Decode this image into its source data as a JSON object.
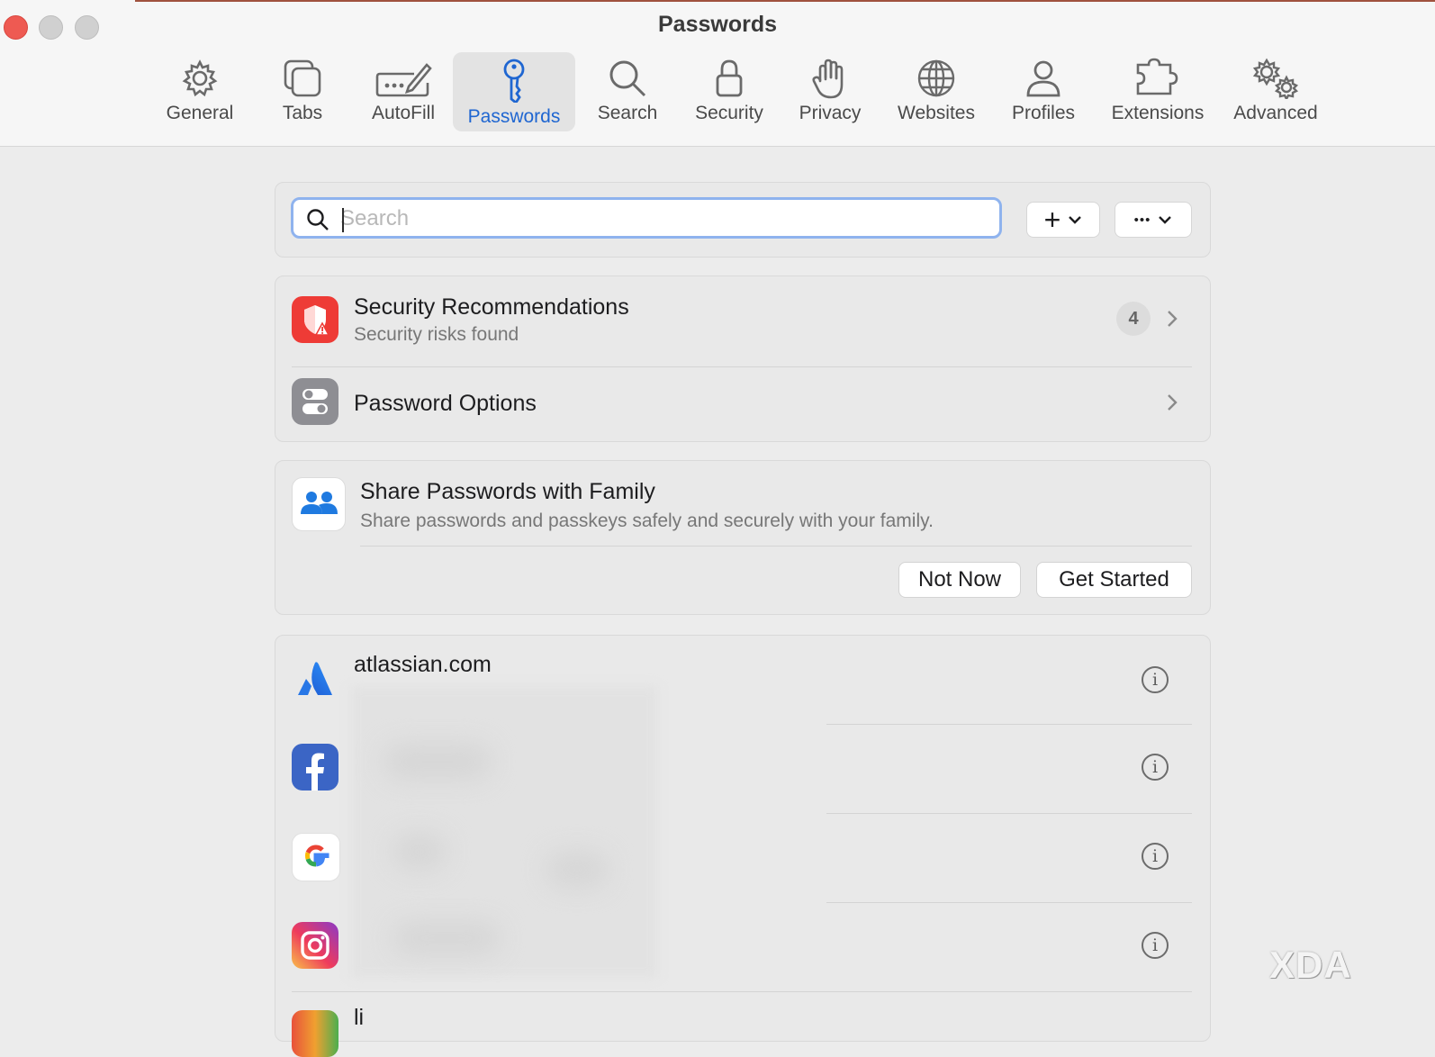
{
  "window": {
    "title": "Passwords"
  },
  "toolbar": {
    "tabs": [
      {
        "label": "General",
        "icon": "gear-icon"
      },
      {
        "label": "Tabs",
        "icon": "tabs-icon"
      },
      {
        "label": "AutoFill",
        "icon": "pencil-field-icon"
      },
      {
        "label": "Passwords",
        "icon": "key-icon",
        "active": true
      },
      {
        "label": "Search",
        "icon": "search-icon"
      },
      {
        "label": "Security",
        "icon": "lock-icon"
      },
      {
        "label": "Privacy",
        "icon": "hand-icon"
      },
      {
        "label": "Websites",
        "icon": "globe-icon"
      },
      {
        "label": "Profiles",
        "icon": "person-icon"
      },
      {
        "label": "Extensions",
        "icon": "puzzle-icon"
      },
      {
        "label": "Advanced",
        "icon": "gears-icon"
      }
    ]
  },
  "search": {
    "placeholder": "Search",
    "value": ""
  },
  "actions": {
    "add": "+",
    "more": "•••"
  },
  "security": {
    "title": "Security Recommendations",
    "subtitle": "Security risks found",
    "count": "4"
  },
  "options": {
    "title": "Password Options"
  },
  "family": {
    "title": "Share Passwords with Family",
    "subtitle": "Share passwords and passkeys safely and securely with your family.",
    "not_now": "Not Now",
    "get_started": "Get Started"
  },
  "passwords": [
    {
      "site": "atlassian.com",
      "icon": "atlassian-icon"
    },
    {
      "site": "",
      "icon": "facebook-icon"
    },
    {
      "site": "",
      "icon": "google-icon"
    },
    {
      "site": "",
      "icon": "instagram-icon"
    },
    {
      "site": "li",
      "icon": "partial-icon"
    }
  ],
  "watermark": "XDA",
  "colors": {
    "accent": "#1f66d1",
    "security_red": "#ee3b36",
    "search_focus": "#8fb3ee"
  }
}
